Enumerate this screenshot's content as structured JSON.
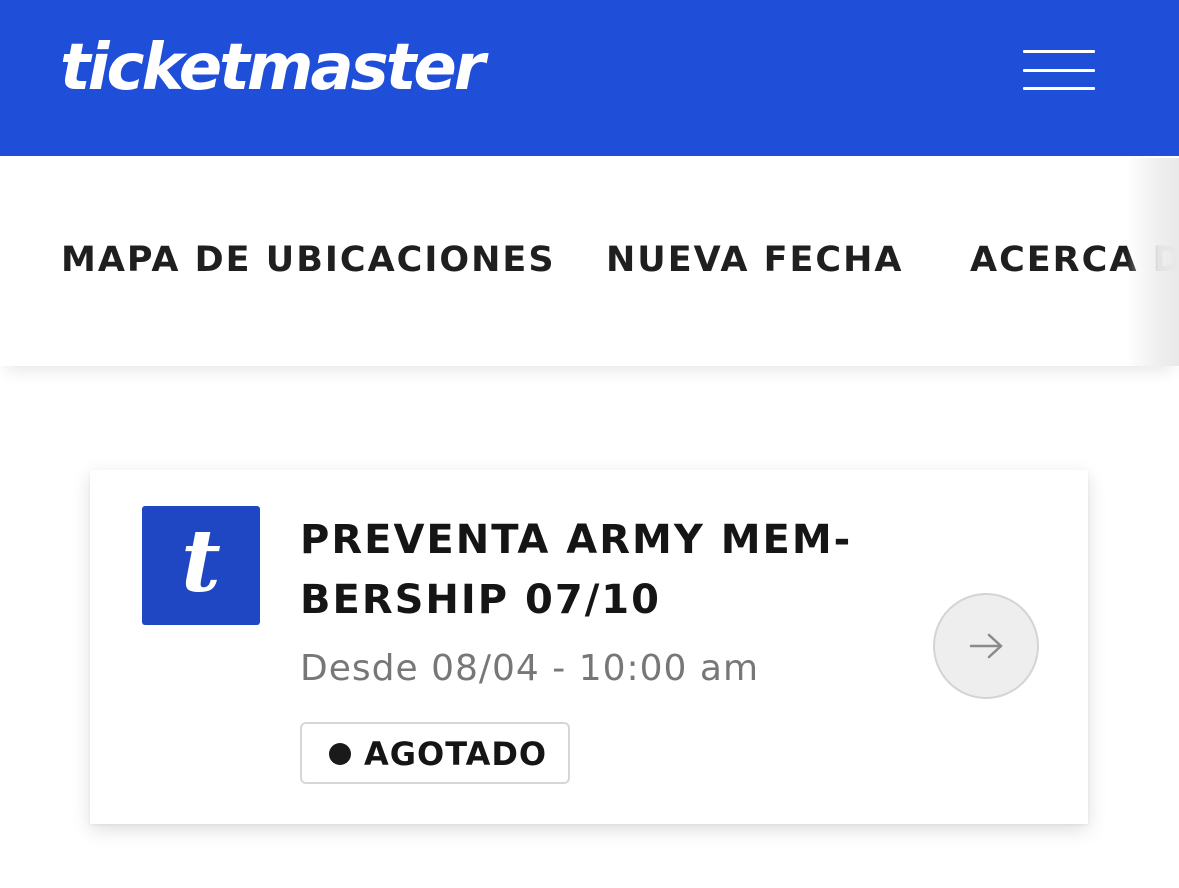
{
  "header": {
    "logo_text": "ticketmaster",
    "menu_icon": "hamburger-menu-icon",
    "background_color": "#1f4ed8"
  },
  "nav": {
    "tabs": [
      {
        "label": "MAPA DE UBICACIONES"
      },
      {
        "label": "NUEVA FECHA"
      },
      {
        "label": "ACERCA DE"
      }
    ]
  },
  "offer_card": {
    "logo_letter": "t",
    "logo_color": "#1f47c4",
    "title_line1": "PREVENTA ARMY MEM-",
    "title_line2": "BERSHIP 07/10",
    "date_text": "Desde 08/04 - 10:00 am",
    "status_label": "AGOTADO",
    "arrow_icon": "arrow-right-icon"
  }
}
